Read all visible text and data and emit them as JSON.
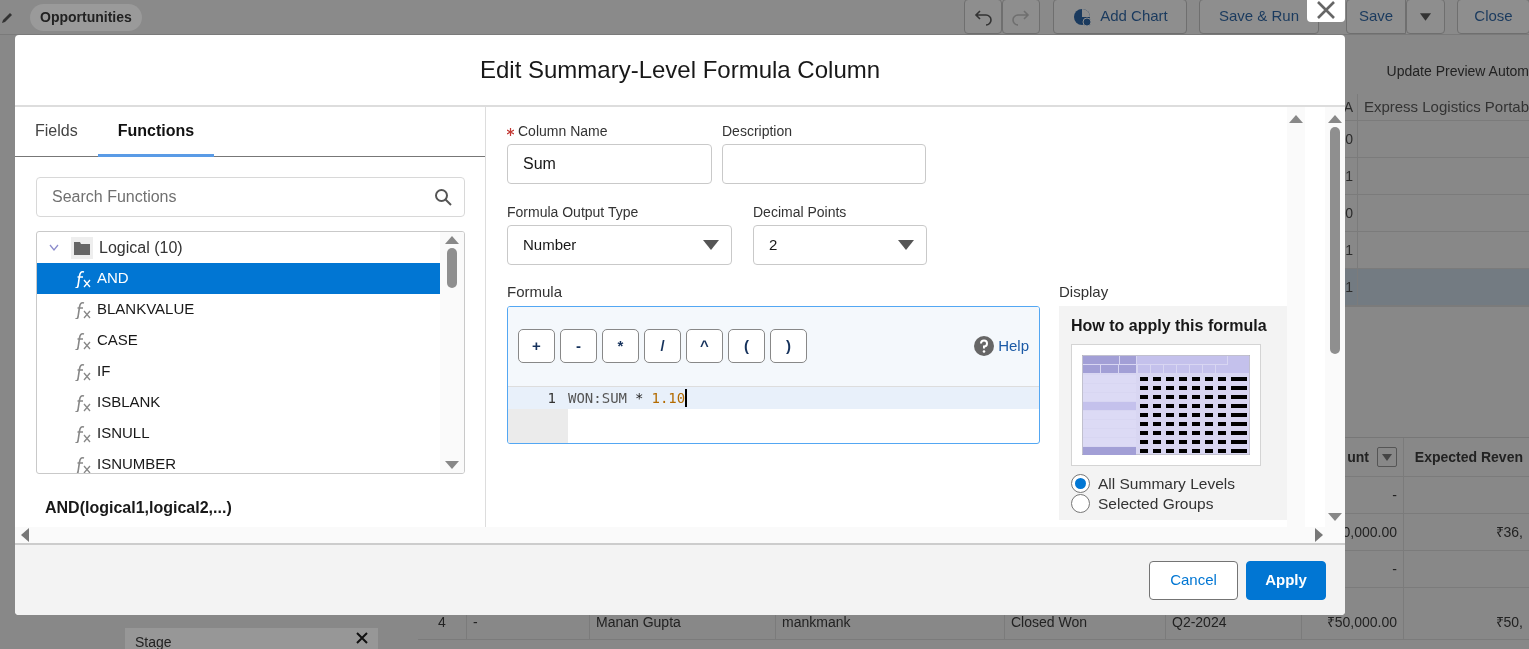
{
  "background_page": {
    "tab": "Opportunities",
    "toolbar": [
      {
        "kind": "undo",
        "disabled": false
      },
      {
        "kind": "redo",
        "disabled": true
      },
      {
        "kind": "chart",
        "label": "Add Chart"
      },
      {
        "kind": "text",
        "label": "Save & Run"
      },
      {
        "kind": "text",
        "label": "Save"
      },
      {
        "kind": "menu"
      },
      {
        "kind": "text",
        "label": "Close"
      }
    ],
    "preview_button": "Update Preview Autom",
    "table_1": {
      "columns": [
        "A",
        "Express Logistics Portab"
      ],
      "rows": [
        {
          "value": "0",
          "selected": false
        },
        {
          "value": "1",
          "selected": false
        },
        {
          "value": "0",
          "selected": false
        },
        {
          "value": "1",
          "selected": false
        },
        {
          "value": "1",
          "selected": true
        }
      ]
    },
    "table_2": {
      "columns": [
        "unt",
        "Expected Reven"
      ],
      "rows": [
        {
          "amount": "-"
        },
        {
          "amount": "0,000.00",
          "expected": "₹36,"
        },
        {
          "amount": "-"
        },
        {
          "cells": [
            "4",
            "-",
            "Manan Gupta",
            "mankmank",
            "Closed Won",
            "Q2-2024"
          ],
          "amount": "₹50,000.00",
          "expected": "₹50,"
        }
      ]
    },
    "filter_chip": "Stage"
  },
  "dialog": {
    "title": "Edit Summary-Level Formula Column",
    "tabs": [
      {
        "label": "Fields",
        "selected": false
      },
      {
        "label": "Functions",
        "selected": true
      }
    ],
    "search": {
      "placeholder": "Search Functions"
    },
    "function_tree": [
      {
        "label": "Logical (10)",
        "expanded": true,
        "children": [
          {
            "label": "AND",
            "selected": true
          },
          {
            "label": "BLANKVALUE",
            "selected": false
          },
          {
            "label": "CASE",
            "selected": false
          },
          {
            "label": "IF",
            "selected": false
          },
          {
            "label": "ISBLANK",
            "selected": false
          },
          {
            "label": "ISNULL",
            "selected": false
          },
          {
            "label": "ISNUMBER",
            "selected": false
          }
        ]
      }
    ],
    "function_signature": "AND(logical1,logical2,...)",
    "column_name": {
      "label": "Column Name",
      "required": true,
      "value": "Sum"
    },
    "description": {
      "label": "Description"
    },
    "output_type": {
      "label": "Formula Output Type",
      "value": "Number"
    },
    "decimal_points": {
      "label": "Decimal Points",
      "value": "2"
    },
    "formula": {
      "label": "Formula",
      "operators": [
        "+",
        "-",
        "*",
        "/",
        "^",
        "(",
        ")"
      ],
      "help": "Help",
      "lines": [
        {
          "number": "1",
          "tokens": [
            {
              "text": "WON:SUM",
              "kind": "field"
            },
            {
              "text": "*",
              "kind": "operator"
            },
            {
              "text": "1.10",
              "kind": "number"
            }
          ]
        }
      ]
    },
    "display": {
      "label": "Display",
      "heading": "How to apply this formula",
      "options": [
        {
          "label": "All Summary Levels",
          "selected": true
        },
        {
          "label": "Selected Groups",
          "selected": false
        }
      ]
    },
    "buttons": [
      {
        "label": "Cancel",
        "kind": "secondary"
      },
      {
        "label": "Apply",
        "kind": "primary"
      }
    ]
  }
}
